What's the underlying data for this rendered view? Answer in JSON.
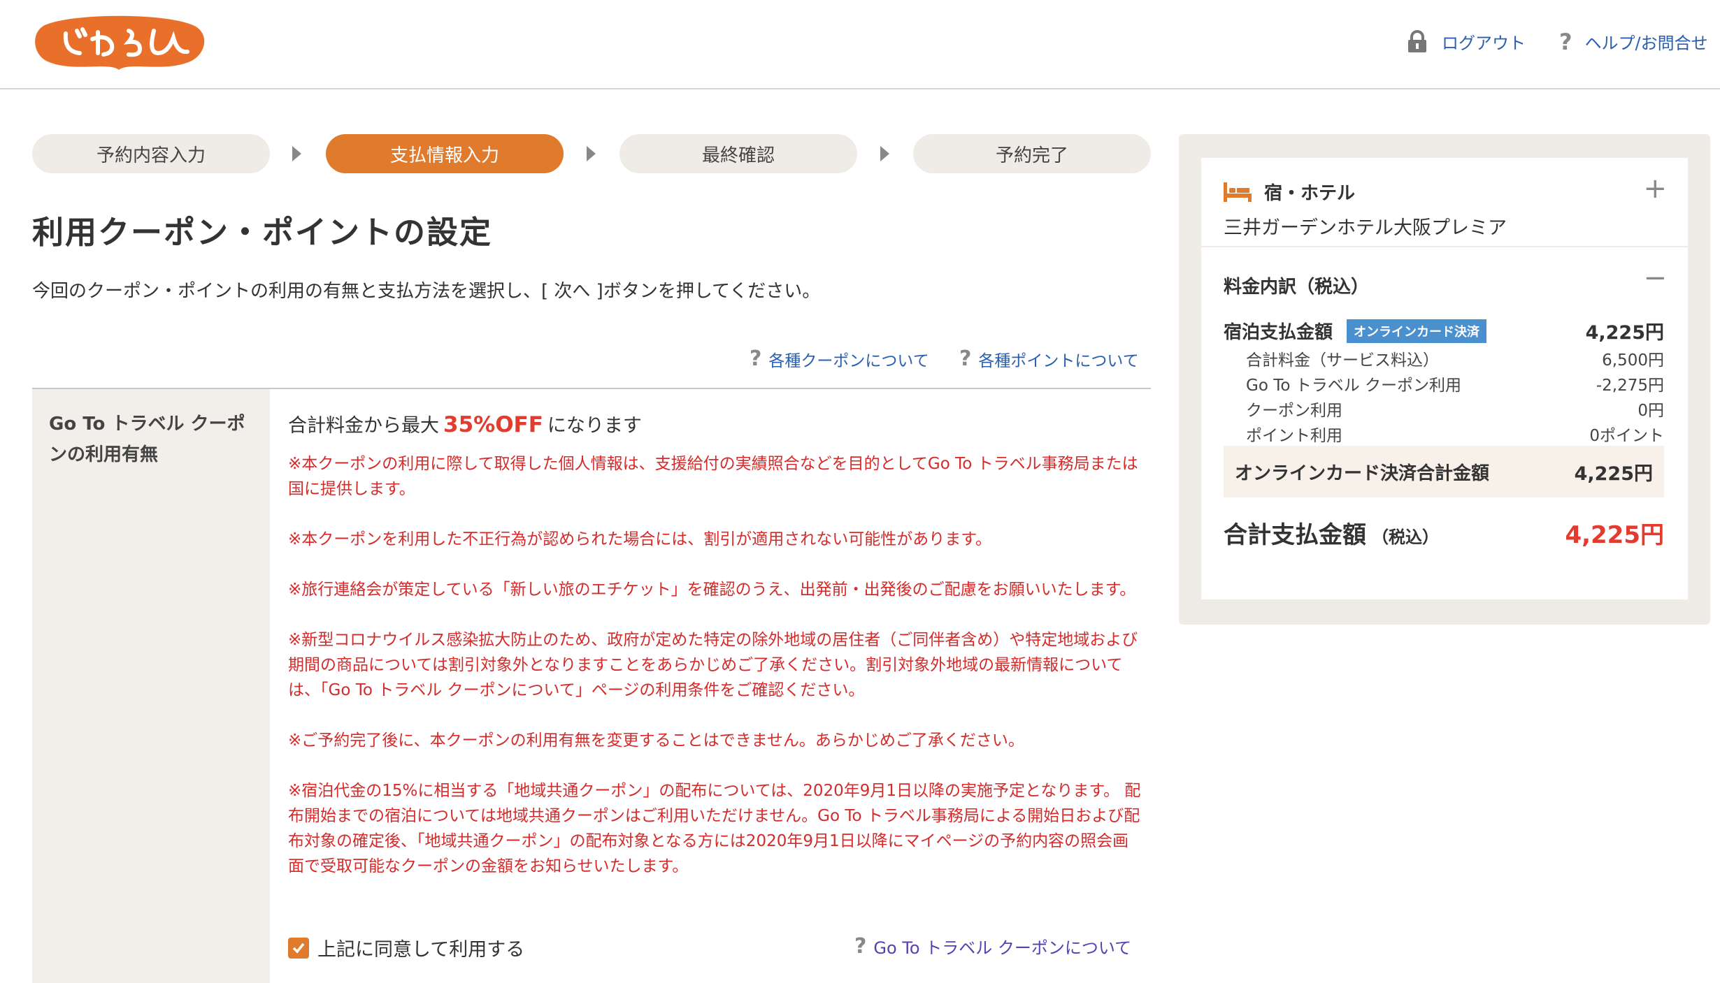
{
  "brand": {
    "logo_text": "じゃらん",
    "accent": "#e07b2e",
    "red": "#e33b2d",
    "link": "#2a5fb0"
  },
  "header": {
    "logout_label": "ログアウト",
    "help_label": "ヘルプ/お問合せ"
  },
  "steps": [
    {
      "label": "予約内容入力",
      "active": false
    },
    {
      "label": "支払情報入力",
      "active": true
    },
    {
      "label": "最終確認",
      "active": false
    },
    {
      "label": "予約完了",
      "active": false
    }
  ],
  "page": {
    "title": "利用クーポン・ポイントの設定",
    "intro": "今回のクーポン・ポイントの利用の有無と支払方法を選択し、[ 次へ ]ボタンを押してください。",
    "coupon_help": "各種クーポンについて",
    "point_help": "各種ポイントについて"
  },
  "goto_section": {
    "label": "Go To トラベル クーポンの利用有無",
    "off_prefix": "合計料金から最大",
    "off_value": "35%OFF",
    "off_suffix": "になります",
    "notes": [
      "※本クーポンの利用に際して取得した個人情報は、支援給付の実績照合などを目的としてGo To トラベル事務局または国に提供します。",
      "※本クーポンを利用した不正行為が認められた場合には、割引が適用されない可能性があります。",
      "※旅行連絡会が策定している「新しい旅のエチケット」を確認のうえ、出発前・出発後のご配慮をお願いいたします。",
      "※新型コロナウイルス感染拡大防止のため、政府が定めた特定の除外地域の居住者（ご同伴者含め）や特定地域および期間の商品については割引対象外となりますことをあらかじめご了承ください。割引対象外地域の最新情報については、「Go To トラベル クーポンについて」ページの利用条件をご確認ください。",
      "※ご予約完了後に、本クーポンの利用有無を変更することはできません。あらかじめご了承ください。",
      "※宿泊代金の15%に相当する「地域共通クーポン」の配布については、2020年9月1日以降の実施予定となります。 配布開始までの宿泊については地域共通クーポンはご利用いただけません。Go To トラベル事務局による開始日および配布対象の確定後、「地域共通クーポン」の配布対象となる方には2020年9月1日以降にマイページの予約内容の照会画面で受取可能なクーポンの金額をお知らせいたします。"
    ],
    "agree_label": "上記に同意して利用する",
    "agree_checked": true,
    "goto_link": "Go To トラベル クーポンについて"
  },
  "sidebar": {
    "category": "宿・ホテル",
    "hotel_name": "三井ガーデンホテル大阪プレミア",
    "breakdown_title": "料金内訳（税込）",
    "pay_label": "宿泊支払金額",
    "pay_badge": "オンラインカード決済",
    "pay_amount": "4,225円",
    "rows": [
      {
        "label": "合計料金（サービス料込）",
        "value": "6,500円"
      },
      {
        "label": "Go To トラベル クーポン利用",
        "value": "-2,275円"
      },
      {
        "label": "クーポン利用",
        "value": "0円"
      },
      {
        "label": "ポイント利用",
        "value": "0ポイント"
      }
    ],
    "card_total_label": "オンラインカード決済合計金額",
    "card_total_amount": "4,225円",
    "total_label": "合計支払金額",
    "total_tax": "（税込）",
    "total_amount": "4,225円"
  }
}
